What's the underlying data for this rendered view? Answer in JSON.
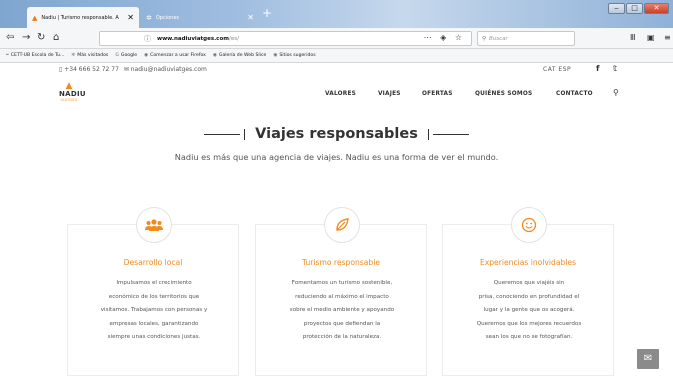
{
  "browser": {
    "tabs": [
      {
        "label": "Nadiu | Turismo responsable. A",
        "active": true
      },
      {
        "label": "Opciones",
        "active": false
      }
    ],
    "url": {
      "host": "www.nadiuviatges.com",
      "path": "/es/"
    },
    "search_placeholder": "Buscar",
    "bookmarks": [
      {
        "label": "CETT-UB Escola de Tu...",
        "icon": "cett-icon"
      },
      {
        "label": "Más visitados",
        "icon": "gear-icon"
      },
      {
        "label": "Google",
        "icon": "google-icon"
      },
      {
        "label": "Comenzar a usar Firefox",
        "icon": "firefox-icon"
      },
      {
        "label": "Galería de Web Slice",
        "icon": "webslice-icon"
      },
      {
        "label": "Sitios sugeridos",
        "icon": "suggested-icon"
      }
    ]
  },
  "site": {
    "topbar": {
      "phone": "+34 666 52 72 77",
      "email": "nadiu@nadiuviatges.com",
      "lang_cat": "CAT",
      "lang_esp": "ESP"
    },
    "logo": {
      "name": "NADIU",
      "sub": "VIATGES"
    },
    "nav": [
      "VALORES",
      "VIAJES",
      "OFERTAS",
      "QUIÉNES SOMOS",
      "CONTACTO"
    ],
    "hero": {
      "title": "Viajes responsables",
      "subtitle": "Nadiu es más que una agencia de viajes. Nadiu es una forma de ver el mundo."
    },
    "cards": [
      {
        "title": "Desarrollo local",
        "icon": "people-icon",
        "lines": [
          "Impulsamos el crecimiento",
          "económico de los territorios que",
          "visitamos. Trabajamos con personas y",
          "empresas locales, garantizando",
          "siempre unas condiciones justas."
        ]
      },
      {
        "title": "Turismo responsable",
        "icon": "leaf-icon",
        "lines": [
          "Fomentamos un turismo sostenible,",
          "reduciendo al máximo el impacto",
          "sobre el medio ambiente y apoyando",
          "proyectos que defiendan la",
          "protección de la naturaleza."
        ]
      },
      {
        "title": "Experiencias inolvidables",
        "icon": "smile-icon",
        "lines": [
          "Queremos que viajéis sin",
          "prisa, conociendo en profundidad el",
          "lugar y la gente que os acogerá.",
          "Queremos que los mejores recuerdos",
          "sean los que no se fotografían."
        ]
      }
    ]
  }
}
